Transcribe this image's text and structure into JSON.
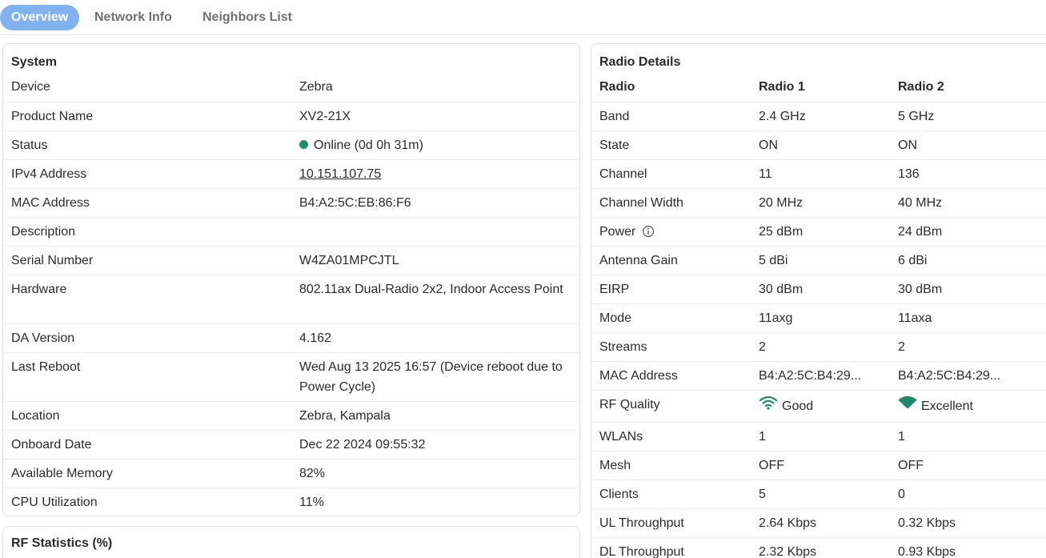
{
  "tabs": [
    {
      "label": "Overview",
      "active": true
    },
    {
      "label": "Network Info",
      "active": false
    },
    {
      "label": "Neighbors List",
      "active": false
    }
  ],
  "system": {
    "title": "System",
    "rows": [
      {
        "label": "Device",
        "value": "Zebra"
      },
      {
        "label": "Product Name",
        "value": "XV2-21X"
      },
      {
        "label": "Status",
        "value": "Online (0d 0h 31m)"
      },
      {
        "label": "IPv4 Address",
        "value": "10.151.107.75"
      },
      {
        "label": "MAC Address",
        "value": "B4:A2:5C:EB:86:F6"
      },
      {
        "label": "Description",
        "value": ""
      },
      {
        "label": "Serial Number",
        "value": "W4ZA01MPCJTL"
      },
      {
        "label": "Hardware",
        "value": "802.11ax Dual-Radio 2x2, Indoor Access Point"
      },
      {
        "label": "DA Version",
        "value": "4.162"
      },
      {
        "label": "Last Reboot",
        "value": "Wed Aug 13 2025 16:57 (Device reboot due to Power Cycle)"
      },
      {
        "label": "Location",
        "value": "Zebra, Kampala"
      },
      {
        "label": "Onboard Date",
        "value": "Dec 22 2024 09:55:32"
      },
      {
        "label": "Available Memory",
        "value": "82%"
      },
      {
        "label": "CPU Utilization",
        "value": "11%"
      }
    ]
  },
  "rf_statistics": {
    "title": "RF Statistics (%)"
  },
  "radio": {
    "title": "Radio Details",
    "headers": [
      "Radio",
      "Radio 1",
      "Radio 2"
    ],
    "rows": [
      {
        "label": "Band",
        "r1": "2.4 GHz",
        "r2": "5 GHz"
      },
      {
        "label": "State",
        "r1": "ON",
        "r2": "ON"
      },
      {
        "label": "Channel",
        "r1": "11",
        "r2": "136"
      },
      {
        "label": "Channel Width",
        "r1": "20 MHz",
        "r2": "40 MHz"
      },
      {
        "label": "Power",
        "r1": "25 dBm",
        "r2": "24 dBm"
      },
      {
        "label": "Antenna Gain",
        "r1": "5 dBi",
        "r2": "6 dBi"
      },
      {
        "label": "EIRP",
        "r1": "30 dBm",
        "r2": "30 dBm"
      },
      {
        "label": "Mode",
        "r1": "11axg",
        "r2": "11axa"
      },
      {
        "label": "Streams",
        "r1": "2",
        "r2": "2"
      },
      {
        "label": "MAC Address",
        "r1": "B4:A2:5C:B4:29...",
        "r2": "B4:A2:5C:B4:29..."
      },
      {
        "label": "RF Quality",
        "r1": "Good",
        "r2": "Excellent"
      },
      {
        "label": "WLANs",
        "r1": "1",
        "r2": "1"
      },
      {
        "label": "Mesh",
        "r1": "OFF",
        "r2": "OFF"
      },
      {
        "label": "Clients",
        "r1": "5",
        "r2": "0"
      },
      {
        "label": "UL Throughput",
        "r1": "2.64 Kbps",
        "r2": "0.32 Kbps"
      },
      {
        "label": "DL Throughput",
        "r1": "2.32 Kbps",
        "r2": "0.93 Kbps"
      }
    ]
  },
  "colors": {
    "accent": "#7fb2ee",
    "status_online": "#1e8a6a",
    "wifi": "#1e8a6a"
  }
}
